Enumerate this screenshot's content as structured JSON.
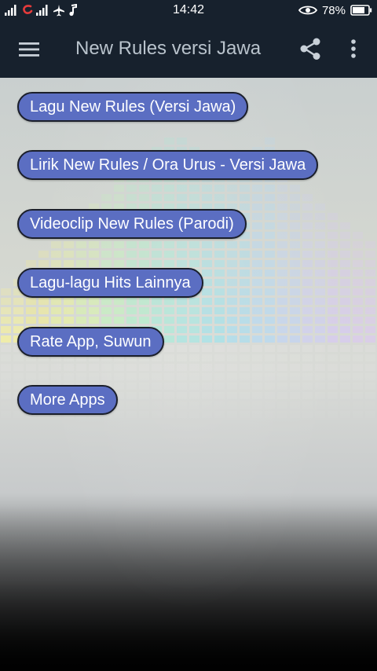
{
  "status_bar": {
    "time": "14:42",
    "battery_percent": "78%",
    "icons": [
      "signal-icon",
      "app-notification-icon",
      "signal-icon",
      "airplane-icon",
      "music-note-icon",
      "eye-icon",
      "battery-icon"
    ]
  },
  "app_bar": {
    "title": "New Rules versi Jawa",
    "icons": [
      "hamburger-menu-icon",
      "share-icon",
      "more-vert-icon"
    ]
  },
  "menu": {
    "items": [
      {
        "label": "Lagu New Rules (Versi Jawa)"
      },
      {
        "label": "Lirik New Rules / Ora Urus - Versi Jawa"
      },
      {
        "label": "Videoclip New Rules (Parodi)"
      },
      {
        "label": "Lagu-lagu Hits Lainnya"
      },
      {
        "label": "Rate App, Suwun"
      },
      {
        "label": "More Apps"
      }
    ]
  },
  "colors": {
    "app_bar_bg": "#17212d",
    "pill_bg": "#5b6ec2",
    "pill_border": "#1b1f2b"
  }
}
